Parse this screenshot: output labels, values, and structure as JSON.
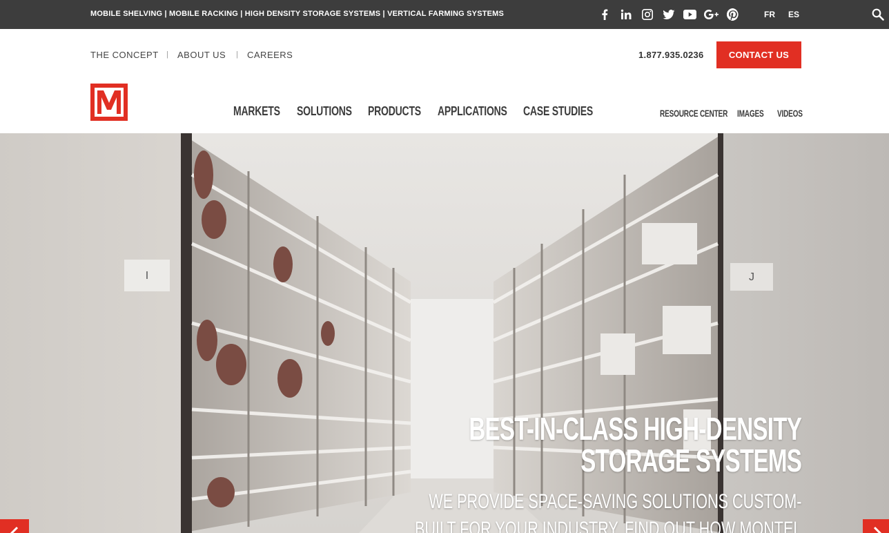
{
  "topbar": {
    "tagline": "MOBILE SHELVING | MOBILE RACKING | HIGH DENSITY STORAGE SYSTEMS | VERTICAL FARMING SYSTEMS",
    "social_icons": [
      "facebook-icon",
      "linkedin-icon",
      "instagram-icon",
      "twitter-icon",
      "youtube-icon",
      "google-plus-icon",
      "pinterest-icon"
    ],
    "languages": [
      "FR",
      "ES"
    ],
    "background": "#3d3d3d"
  },
  "utility_nav": {
    "items": [
      "THE CONCEPT",
      "ABOUT US",
      "CAREERS"
    ],
    "separator": "|",
    "phone": "1.877.935.0236",
    "contact_label": "CONTACT US",
    "accent": "#e12f23"
  },
  "main_nav": {
    "items": [
      "MARKETS",
      "SOLUTIONS",
      "PRODUCTS",
      "APPLICATIONS",
      "CASE STUDIES"
    ],
    "secondary": [
      "RESOURCE CENTER",
      "IMAGES",
      "VIDEOS"
    ]
  },
  "hero": {
    "title_line1": "BEST-IN-CLASS HIGH-DENSITY",
    "title_line2": "STORAGE SYSTEMS",
    "subtitle_line1": "WE PROVIDE SPACE-SAVING SOLUTIONS CUSTOM-",
    "subtitle_line2": "BUILT FOR YOUR INDUSTRY. FIND OUT HOW MONTEL",
    "label_left": "I",
    "label_right": "J"
  }
}
